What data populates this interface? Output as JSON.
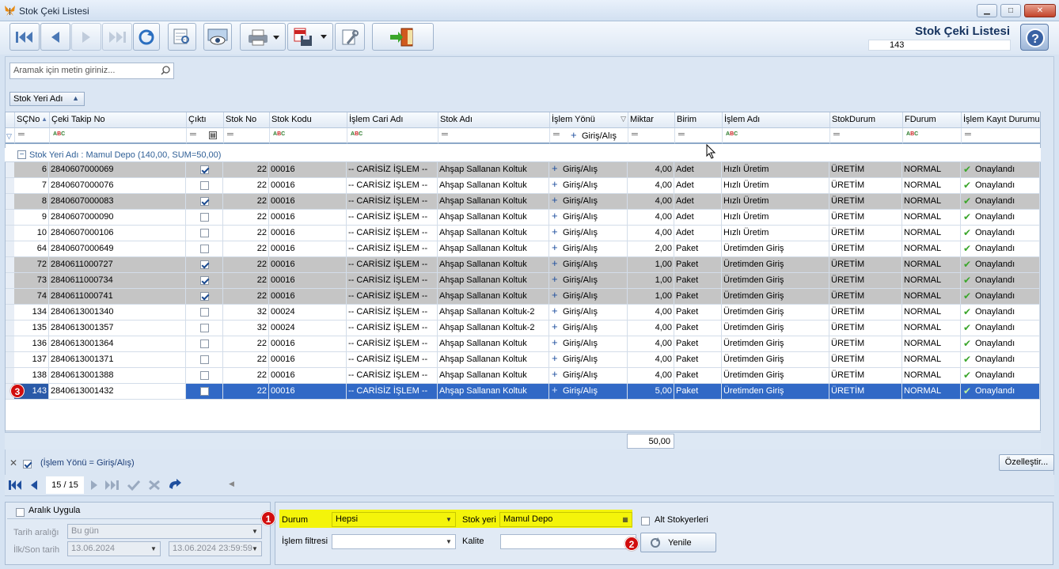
{
  "window": {
    "title": "Stok Çeki Listesi",
    "min": "▁",
    "max": "□",
    "close": "✕"
  },
  "header": {
    "title": "Stok Çeki Listesi",
    "count": "143"
  },
  "search": {
    "placeholder": "Aramak için metin giriniz..."
  },
  "group_button": {
    "label": "Stok Yeri Adı"
  },
  "columns": [
    "SÇNo",
    "Çeki Takip No",
    "Çıktı",
    "Stok No",
    "Stok Kodu",
    "İşlem Cari Adı",
    "Stok Adı",
    "İşlem Yönü",
    "Miktar",
    "Birim",
    "İşlem Adı",
    "StokDurum",
    "FDurum",
    "İşlem Kayıt Durumu"
  ],
  "filter_row": {
    "islem_yonu": "Giriş/Alış"
  },
  "group_row": {
    "label": "Stok Yeri Adı : Mamul Depo (140,00, SUM=50,00)"
  },
  "rows": [
    {
      "sc": "6",
      "takip": "2840607000069",
      "cikti": true,
      "stokno": "22",
      "kod": "00016",
      "cari": "-- CARİSİZ İŞLEM --",
      "adi": "Ahşap Sallanan Koltuk",
      "yon": "Giriş/Alış",
      "miktar": "4,00",
      "birim": "Adet",
      "islem": "Hızlı Üretim",
      "sdurum": "ÜRETİM",
      "fdurum": "NORMAL",
      "kayit": "Onaylandı",
      "shade": true
    },
    {
      "sc": "7",
      "takip": "2840607000076",
      "cikti": false,
      "stokno": "22",
      "kod": "00016",
      "cari": "-- CARİSİZ İŞLEM --",
      "adi": "Ahşap Sallanan Koltuk",
      "yon": "Giriş/Alış",
      "miktar": "4,00",
      "birim": "Adet",
      "islem": "Hızlı Üretim",
      "sdurum": "ÜRETİM",
      "fdurum": "NORMAL",
      "kayit": "Onaylandı",
      "shade": false
    },
    {
      "sc": "8",
      "takip": "2840607000083",
      "cikti": true,
      "stokno": "22",
      "kod": "00016",
      "cari": "-- CARİSİZ İŞLEM --",
      "adi": "Ahşap Sallanan Koltuk",
      "yon": "Giriş/Alış",
      "miktar": "4,00",
      "birim": "Adet",
      "islem": "Hızlı Üretim",
      "sdurum": "ÜRETİM",
      "fdurum": "NORMAL",
      "kayit": "Onaylandı",
      "shade": true
    },
    {
      "sc": "9",
      "takip": "2840607000090",
      "cikti": false,
      "stokno": "22",
      "kod": "00016",
      "cari": "-- CARİSİZ İŞLEM --",
      "adi": "Ahşap Sallanan Koltuk",
      "yon": "Giriş/Alış",
      "miktar": "4,00",
      "birim": "Adet",
      "islem": "Hızlı Üretim",
      "sdurum": "ÜRETİM",
      "fdurum": "NORMAL",
      "kayit": "Onaylandı",
      "shade": false
    },
    {
      "sc": "10",
      "takip": "2840607000106",
      "cikti": false,
      "stokno": "22",
      "kod": "00016",
      "cari": "-- CARİSİZ İŞLEM --",
      "adi": "Ahşap Sallanan Koltuk",
      "yon": "Giriş/Alış",
      "miktar": "4,00",
      "birim": "Adet",
      "islem": "Hızlı Üretim",
      "sdurum": "ÜRETİM",
      "fdurum": "NORMAL",
      "kayit": "Onaylandı",
      "shade": false
    },
    {
      "sc": "64",
      "takip": "2840607000649",
      "cikti": false,
      "stokno": "22",
      "kod": "00016",
      "cari": "-- CARİSİZ İŞLEM --",
      "adi": "Ahşap Sallanan Koltuk",
      "yon": "Giriş/Alış",
      "miktar": "2,00",
      "birim": "Paket",
      "islem": "Üretimden Giriş",
      "sdurum": "ÜRETİM",
      "fdurum": "NORMAL",
      "kayit": "Onaylandı",
      "shade": false
    },
    {
      "sc": "72",
      "takip": "2840611000727",
      "cikti": true,
      "stokno": "22",
      "kod": "00016",
      "cari": "-- CARİSİZ İŞLEM --",
      "adi": "Ahşap Sallanan Koltuk",
      "yon": "Giriş/Alış",
      "miktar": "1,00",
      "birim": "Paket",
      "islem": "Üretimden Giriş",
      "sdurum": "ÜRETİM",
      "fdurum": "NORMAL",
      "kayit": "Onaylandı",
      "shade": true
    },
    {
      "sc": "73",
      "takip": "2840611000734",
      "cikti": true,
      "stokno": "22",
      "kod": "00016",
      "cari": "-- CARİSİZ İŞLEM --",
      "adi": "Ahşap Sallanan Koltuk",
      "yon": "Giriş/Alış",
      "miktar": "1,00",
      "birim": "Paket",
      "islem": "Üretimden Giriş",
      "sdurum": "ÜRETİM",
      "fdurum": "NORMAL",
      "kayit": "Onaylandı",
      "shade": true
    },
    {
      "sc": "74",
      "takip": "2840611000741",
      "cikti": true,
      "stokno": "22",
      "kod": "00016",
      "cari": "-- CARİSİZ İŞLEM --",
      "adi": "Ahşap Sallanan Koltuk",
      "yon": "Giriş/Alış",
      "miktar": "1,00",
      "birim": "Paket",
      "islem": "Üretimden Giriş",
      "sdurum": "ÜRETİM",
      "fdurum": "NORMAL",
      "kayit": "Onaylandı",
      "shade": true
    },
    {
      "sc": "134",
      "takip": "2840613001340",
      "cikti": false,
      "stokno": "32",
      "kod": "00024",
      "cari": "-- CARİSİZ İŞLEM --",
      "adi": "Ahşap Sallanan Koltuk-2",
      "yon": "Giriş/Alış",
      "miktar": "4,00",
      "birim": "Paket",
      "islem": "Üretimden Giriş",
      "sdurum": "ÜRETİM",
      "fdurum": "NORMAL",
      "kayit": "Onaylandı",
      "shade": false
    },
    {
      "sc": "135",
      "takip": "2840613001357",
      "cikti": false,
      "stokno": "32",
      "kod": "00024",
      "cari": "-- CARİSİZ İŞLEM --",
      "adi": "Ahşap Sallanan Koltuk-2",
      "yon": "Giriş/Alış",
      "miktar": "4,00",
      "birim": "Paket",
      "islem": "Üretimden Giriş",
      "sdurum": "ÜRETİM",
      "fdurum": "NORMAL",
      "kayit": "Onaylandı",
      "shade": false
    },
    {
      "sc": "136",
      "takip": "2840613001364",
      "cikti": false,
      "stokno": "22",
      "kod": "00016",
      "cari": "-- CARİSİZ İŞLEM --",
      "adi": "Ahşap Sallanan Koltuk",
      "yon": "Giriş/Alış",
      "miktar": "4,00",
      "birim": "Paket",
      "islem": "Üretimden Giriş",
      "sdurum": "ÜRETİM",
      "fdurum": "NORMAL",
      "kayit": "Onaylandı",
      "shade": false
    },
    {
      "sc": "137",
      "takip": "2840613001371",
      "cikti": false,
      "stokno": "22",
      "kod": "00016",
      "cari": "-- CARİSİZ İŞLEM --",
      "adi": "Ahşap Sallanan Koltuk",
      "yon": "Giriş/Alış",
      "miktar": "4,00",
      "birim": "Paket",
      "islem": "Üretimden Giriş",
      "sdurum": "ÜRETİM",
      "fdurum": "NORMAL",
      "kayit": "Onaylandı",
      "shade": false
    },
    {
      "sc": "138",
      "takip": "2840613001388",
      "cikti": false,
      "stokno": "22",
      "kod": "00016",
      "cari": "-- CARİSİZ İŞLEM --",
      "adi": "Ahşap Sallanan Koltuk",
      "yon": "Giriş/Alış",
      "miktar": "4,00",
      "birim": "Paket",
      "islem": "Üretimden Giriş",
      "sdurum": "ÜRETİM",
      "fdurum": "NORMAL",
      "kayit": "Onaylandı",
      "shade": false
    },
    {
      "sc": "143",
      "takip": "2840613001432",
      "cikti": false,
      "stokno": "22",
      "kod": "00016",
      "cari": "-- CARİSİZ İŞLEM --",
      "adi": "Ahşap Sallanan Koltuk",
      "yon": "Giriş/Alış",
      "miktar": "5,00",
      "birim": "Paket",
      "islem": "Üretimden Giriş",
      "sdurum": "ÜRETİM",
      "fdurum": "NORMAL",
      "kayit": "Onaylandı",
      "shade": false,
      "selected": true
    }
  ],
  "footer": {
    "sum": "50,00"
  },
  "filterbar": {
    "text": "(İşlem Yönü = Giriş/Alış)",
    "customize": "Özelleştir..."
  },
  "nav": {
    "page": "15 / 15"
  },
  "date_panel": {
    "apply_label": "Aralık Uygula",
    "range_label": "Tarih aralığı",
    "range_value": "Bu gün",
    "first_last_label": "İlk/Son tarih",
    "start": "13.06.2024",
    "end": "13.06.2024 23:59:59"
  },
  "filter_panel": {
    "durum_label": "Durum",
    "durum_value": "Hepsi",
    "stokyeri_label": "Stok yeri",
    "stokyeri_value": "Mamul Depo",
    "alt_label": "Alt Stokyerleri",
    "islem_filtre_label": "İşlem filtresi",
    "islem_filtre_value": "",
    "kalite_label": "Kalite",
    "kalite_value": "",
    "refresh_label": "Yenile"
  },
  "badges": {
    "b1": "1",
    "b2": "2",
    "b3": "3"
  },
  "colors": {
    "shade_row": "#c5c5c5",
    "selected_row": "#3169c6",
    "highlight": "#f4f40a",
    "header_title": "#15325e",
    "badge": "#d10d0d"
  }
}
